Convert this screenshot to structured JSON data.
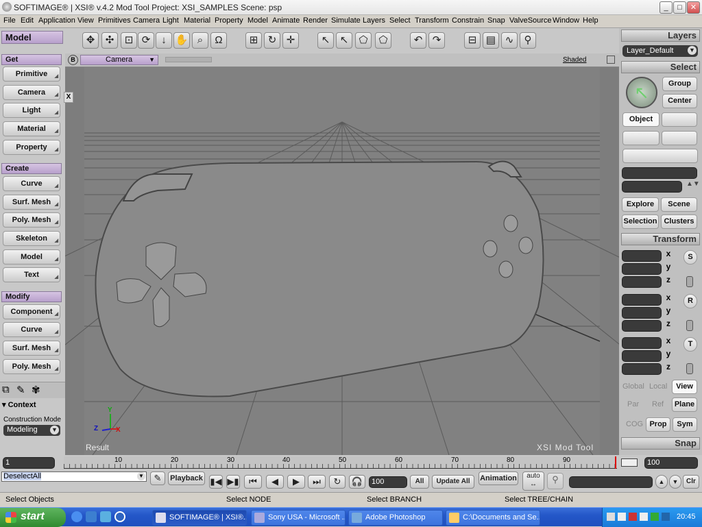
{
  "window": {
    "title": "SOFTIMAGE® | XSI® v.4.2 Mod Tool Project: XSI_SAMPLES    Scene: psp",
    "min": "_",
    "max": "□",
    "close": "✕"
  },
  "menu": [
    "File",
    "Edit",
    "Application",
    "View",
    "Primitives",
    "Camera",
    "Light",
    "Material",
    "Property",
    "Model",
    "Animate",
    "Render",
    "Simulate",
    "Layers",
    "Select",
    "Transform",
    "Constrain",
    "Snap",
    "ValveSource",
    "Window",
    "Help"
  ],
  "left": {
    "model_tab": "Model",
    "get": "Get",
    "get_items": [
      "Primitive",
      "Camera",
      "Light",
      "Material",
      "Property"
    ],
    "create": "Create",
    "create_items": [
      "Curve",
      "Surf. Mesh",
      "Poly. Mesh",
      "Skeleton",
      "Model",
      "Text"
    ],
    "modify": "Modify",
    "modify_items": [
      "Component",
      "Curve",
      "Surf. Mesh",
      "Poly. Mesh"
    ],
    "context": "Context",
    "construction_mode": "Construction Mode",
    "mode_value": "Modeling"
  },
  "viewport": {
    "b_label": "B",
    "camera": "Camera",
    "shaded": "Shaded",
    "result": "Result",
    "watermark": "XSI Mod Tool",
    "close_x": "X",
    "axis_y": "Y",
    "axis_z": "Z",
    "axis_x": "X"
  },
  "right": {
    "layers": "Layers",
    "layer_value": "Layer_Default",
    "select": "Select",
    "group": "Group",
    "center": "Center",
    "object": "Object",
    "explore": "Explore",
    "scene": "Scene",
    "selection": "Selection",
    "clusters": "Clusters",
    "transform": "Transform",
    "x": "x",
    "y": "y",
    "z": "z",
    "s": "S",
    "r": "R",
    "t": "T",
    "global": "Global",
    "local": "Local",
    "view": "View",
    "par": "Par",
    "ref": "Ref",
    "plane": "Plane",
    "cog": "COG",
    "prop": "Prop",
    "sym": "Sym",
    "snap": "Snap"
  },
  "timeline": {
    "start": "1",
    "end": "100",
    "ticks": [
      "10",
      "20",
      "30",
      "40",
      "50",
      "60",
      "70",
      "80",
      "90"
    ]
  },
  "playbar": {
    "command": "DeselectAll",
    "playback": "Playback",
    "frame": "100",
    "all": "All",
    "update_all": "Update All",
    "animation": "Animation",
    "auto": "auto",
    "clr": "Clr"
  },
  "status": {
    "left": "Select Objects",
    "mid1": "Select NODE",
    "mid2": "Select BRANCH",
    "mid3": "Select TREE/CHAIN"
  },
  "taskbar": {
    "start": "start",
    "tasks": [
      "SOFTIMAGE® | XSI®...",
      "Sony USA - Microsoft ...",
      "Adobe Photoshop",
      "C:\\Documents and Se..."
    ],
    "clock": "20:45"
  }
}
